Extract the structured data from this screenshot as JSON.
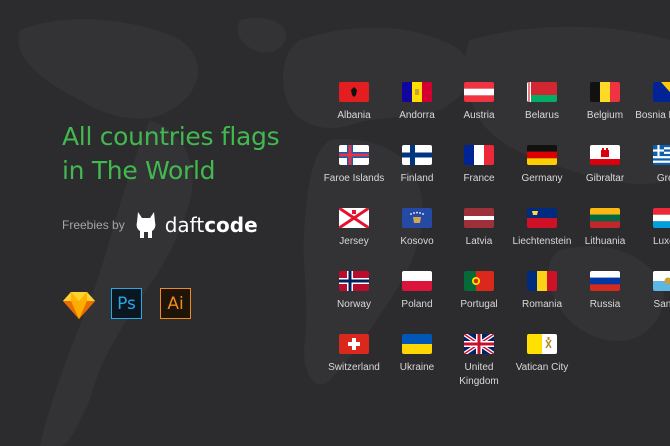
{
  "title": {
    "line1": "All countries flags",
    "line2": "in The World"
  },
  "credit": {
    "prefix": "Freebies by",
    "brand_light": "daft",
    "brand_bold": "code"
  },
  "tools": [
    {
      "icon": "sketch-icon"
    },
    {
      "icon": "photoshop-icon",
      "label": "Ps"
    },
    {
      "icon": "illustrator-icon",
      "label": "Ai"
    }
  ],
  "flags": {
    "albania": "Albania",
    "andorra": "Andorra",
    "austria": "Austria",
    "belarus": "Belarus",
    "belgium": "Belgium",
    "bosnia": "Bosnia Herzeg",
    "faroe": "Faroe Islands",
    "finland": "Finland",
    "france": "France",
    "germany": "Germany",
    "gibraltar": "Gibraltar",
    "greece": "Gree",
    "jersey": "Jersey",
    "kosovo": "Kosovo",
    "latvia": "Latvia",
    "liechtenstein": "Liechtenstein",
    "lithuania": "Lithuania",
    "luxembourg": "Luxem",
    "norway": "Norway",
    "poland": "Poland",
    "portugal": "Portugal",
    "romania": "Romania",
    "russia": "Russia",
    "sanmarino": "San M",
    "switzerland": "Switzerland",
    "ukraine": "Ukraine",
    "uk": "United Kingdom",
    "vatican": "Vatican City"
  },
  "colors": {
    "background": "#2c2c2e",
    "title": "#42b94f",
    "label": "#d9d9d9"
  }
}
